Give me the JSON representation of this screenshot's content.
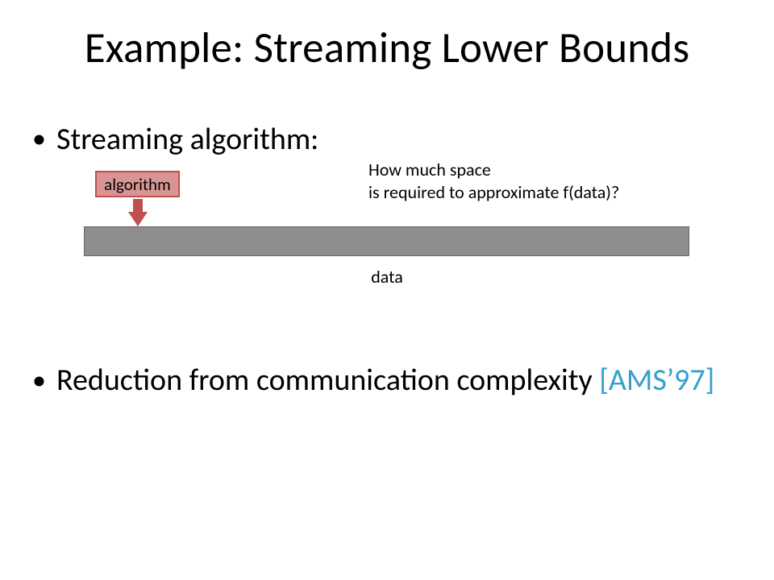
{
  "title": "Example: Streaming Lower Bounds",
  "bullet1": "Streaming algorithm:",
  "bullet2_prefix": "Reduction from communication complexity ",
  "bullet2_cite": "[AMS’97]",
  "algo_box": "algorithm",
  "data_label": "data",
  "question": "How much space\nis required to approximate f(data)?"
}
